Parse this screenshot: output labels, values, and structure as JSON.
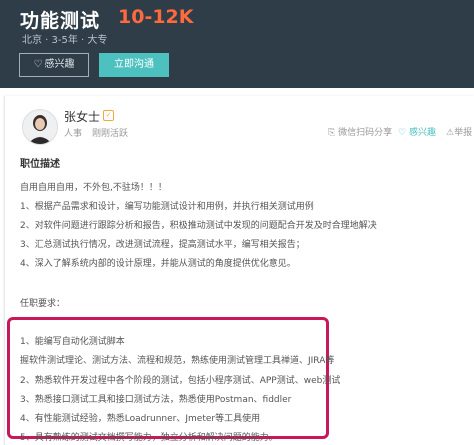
{
  "header": {
    "title": "功能测试",
    "salary": "10-12K",
    "meta": "北京 · 3-5年 · 大专",
    "interest_button": "感兴趣",
    "contact_button": "立即沟通"
  },
  "recruiter": {
    "name": "张女士",
    "role": "人事",
    "status": "刚刚活跃",
    "share_label": "微信扫码分享",
    "interest_label": "感兴趣",
    "report_label": "举报"
  },
  "description": {
    "title": "职位描述",
    "lines": [
      "自用自用自用，不外包,不驻场！！！",
      "1、根据产品需求和设计，编写功能测试设计和用例，并执行相关测试用例",
      "2、对软件问题进行跟踪分析和报告，积极推动测试中发现的问题配合开发及时合理地解决",
      "3、汇总测试执行情况，改进测试流程，提高测试水平，编写相关报告；",
      "4、深入了解系统内部的设计原理，并能从测试的角度提供优化意见。"
    ]
  },
  "requirements": {
    "title": "任职要求：",
    "lines": [
      "1、能编写自动化测试脚本",
      "握软件测试理论、测试方法、流程和规范，熟练使用测试管理工具禅道、JIRA等",
      "2、熟悉软件开发过程中各个阶段的测试，包括小程序测试、APP测试、web测试",
      "3、熟悉接口测试工具和接口测试方法，熟悉使用Postman、fiddler",
      "4、有性能测试经验，熟悉Loadrunner、Jmeter等工具使用",
      "5、具有熟练的测试文档撰写能力，独立分析和解决问题的能力。"
    ]
  },
  "colors": {
    "header_bg": "#2f3d48",
    "salary": "#ff6a3d",
    "accent": "#4cc1bf",
    "highlight_border": "#c8185a"
  }
}
